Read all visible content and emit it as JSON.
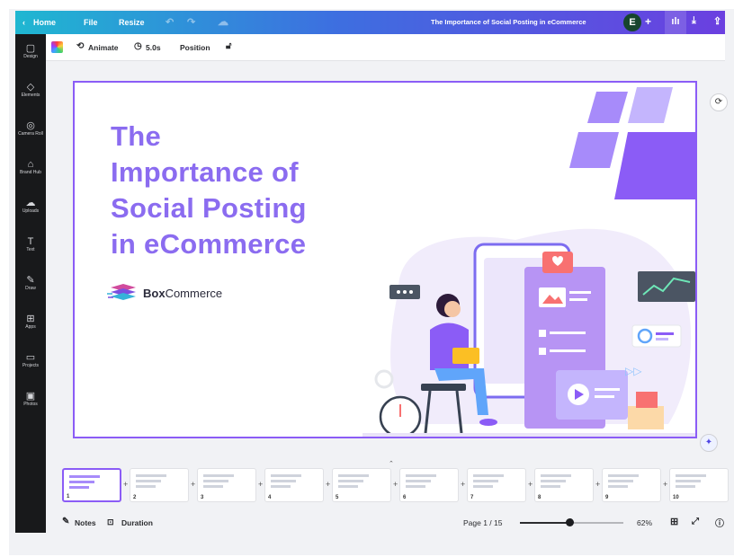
{
  "topbar": {
    "home": "Home",
    "file": "File",
    "resize": "Resize",
    "document_title": "The Importance of Social Posting in eCommerce",
    "avatar_initial": "E",
    "icons": [
      "undo-icon",
      "redo-icon",
      "cloud-save-icon",
      "add-icon",
      "analytics-icon",
      "download-icon",
      "share-icon"
    ]
  },
  "rail": {
    "items": [
      {
        "label": "Design",
        "icon": "▢"
      },
      {
        "label": "Elements",
        "icon": "◇"
      },
      {
        "label": "Camera Roll",
        "icon": "◎"
      },
      {
        "label": "Brand Hub",
        "icon": "⌂"
      },
      {
        "label": "Uploads",
        "icon": "☁"
      },
      {
        "label": "Text",
        "icon": "T"
      },
      {
        "label": "Draw",
        "icon": "✎"
      },
      {
        "label": "Apps",
        "icon": "⊞"
      },
      {
        "label": "Projects",
        "icon": "▭"
      },
      {
        "label": "Photos",
        "icon": "▣"
      }
    ]
  },
  "toolbar": {
    "animate": "Animate",
    "duration": "5.0s",
    "position": "Position"
  },
  "slide": {
    "title_lines": [
      "The",
      "Importance of",
      "Social Posting",
      "in eCommerce"
    ],
    "brand_bold": "Box",
    "brand_rest": "Commerce"
  },
  "thumbnails": [
    "1",
    "2",
    "3",
    "4",
    "5",
    "6",
    "7",
    "8",
    "9",
    "10"
  ],
  "footer": {
    "notes": "Notes",
    "duration": "Duration",
    "page": "Page 1 / 15",
    "zoom": "62%",
    "zoom_fraction": 0.48
  },
  "colors": {
    "accent": "#8b5cf6",
    "title": "#8b6cf0",
    "rail": "#18191b"
  }
}
